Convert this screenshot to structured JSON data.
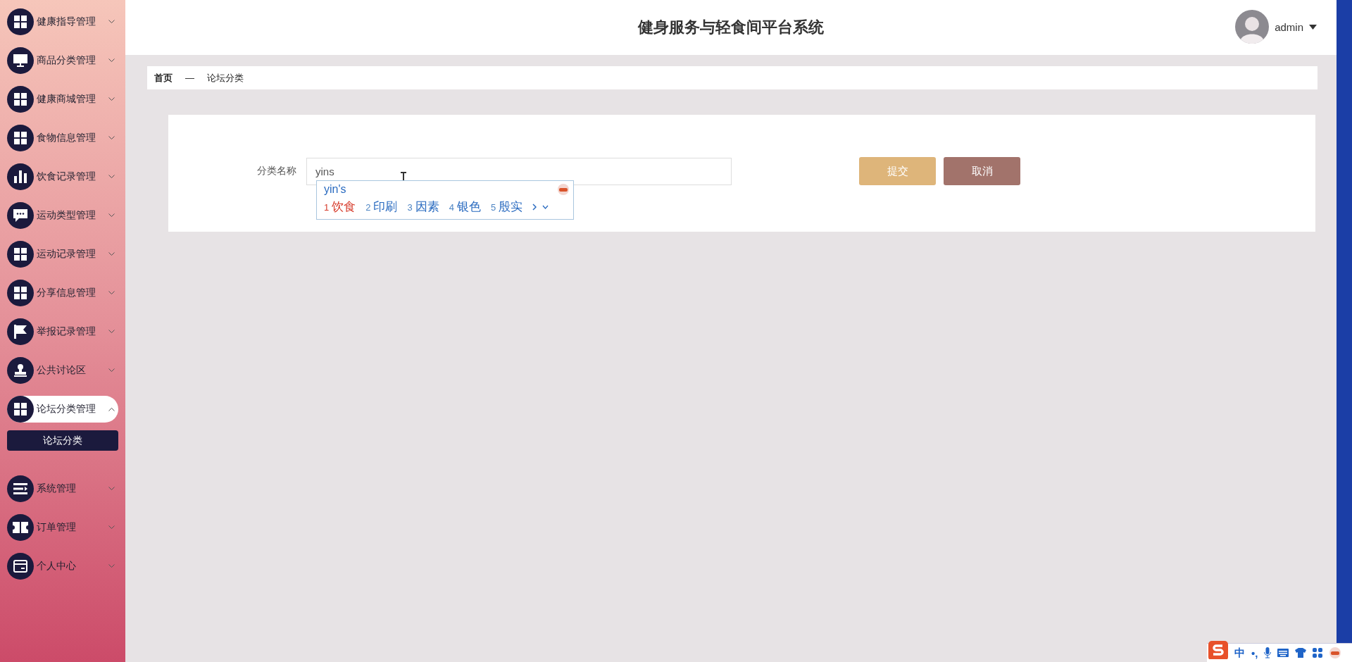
{
  "sidebar": {
    "items": [
      {
        "label": "健康指导管理",
        "expanded": false,
        "selected": false
      },
      {
        "label": "商品分类管理",
        "expanded": false,
        "selected": false
      },
      {
        "label": "健康商城管理",
        "expanded": false,
        "selected": false
      },
      {
        "label": "食物信息管理",
        "expanded": false,
        "selected": false
      },
      {
        "label": "饮食记录管理",
        "expanded": false,
        "selected": false
      },
      {
        "label": "运动类型管理",
        "expanded": false,
        "selected": false
      },
      {
        "label": "运动记录管理",
        "expanded": false,
        "selected": false
      },
      {
        "label": "分享信息管理",
        "expanded": false,
        "selected": false
      },
      {
        "label": "举报记录管理",
        "expanded": false,
        "selected": false
      },
      {
        "label": "公共讨论区",
        "expanded": false,
        "selected": false
      },
      {
        "label": "论坛分类管理",
        "expanded": true,
        "selected": true,
        "children": [
          {
            "label": "论坛分类",
            "selected": true
          }
        ]
      },
      {
        "label": "系统管理",
        "expanded": false,
        "selected": false
      },
      {
        "label": "订单管理",
        "expanded": false,
        "selected": false
      },
      {
        "label": "个人中心",
        "expanded": false,
        "selected": false
      }
    ]
  },
  "header": {
    "title": "健身服务与轻食间平台系统",
    "user": "admin"
  },
  "breadcrumb": [
    "首页",
    "—",
    "论坛分类"
  ],
  "form": {
    "label": "分类名称",
    "value": "yins",
    "buttons": [
      {
        "label": "提交",
        "kind": "primary"
      },
      {
        "label": "取消",
        "kind": "cancel"
      }
    ]
  },
  "ime": {
    "composition": "yin's",
    "candidates": [
      {
        "index": "1",
        "text": "饮食",
        "selected": true
      },
      {
        "index": "2",
        "text": "印刷",
        "selected": false
      },
      {
        "index": "3",
        "text": "因素",
        "selected": false
      },
      {
        "index": "4",
        "text": "银色",
        "selected": false
      },
      {
        "index": "5",
        "text": "殷实",
        "selected": false
      }
    ],
    "tray": {
      "mode": "中",
      "punct": "•,"
    }
  }
}
